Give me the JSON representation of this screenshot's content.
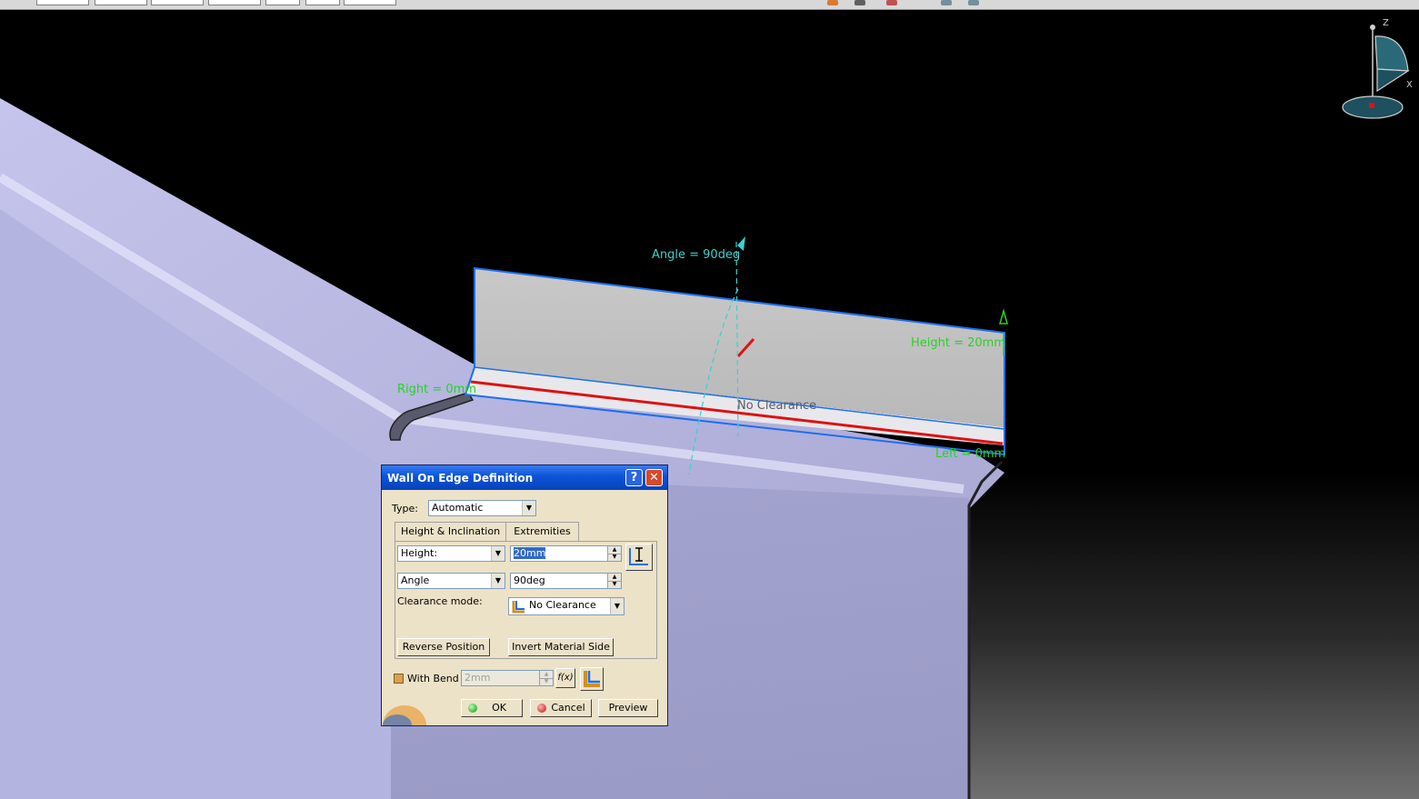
{
  "viewport": {
    "annotations": {
      "angle": "Angle = 90deg",
      "height": "Height = 20mm",
      "right": "Right = 0mm",
      "left": "Left = 0mm",
      "clearance": "No Clearance"
    },
    "compass": {
      "z": "Z",
      "x": "X"
    }
  },
  "dialog": {
    "title": "Wall On Edge Definition",
    "help": "?",
    "close": "✕",
    "type_label": "Type:",
    "type_value": "Automatic",
    "tabs": [
      {
        "label": "Height & Inclination"
      },
      {
        "label": "Extremities"
      }
    ],
    "height_mode": "Height:",
    "height_value": "20mm",
    "angle_mode": "Angle",
    "angle_value": "90deg",
    "clearance_label": "Clearance mode:",
    "clearance_value": "No Clearance",
    "reverse_position": "Reverse Position",
    "invert_material": "Invert Material Side",
    "with_bend_label": "With Bend",
    "bend_radius": "2mm",
    "fx": "f(x)",
    "ok": "OK",
    "cancel": "Cancel",
    "preview": "Preview"
  },
  "colors": {
    "dialog_bg": "#ece2c8",
    "title_bar": "#0a54d8",
    "dimension_green": "#28d228",
    "dimension_cyan": "#3cd0d0",
    "edge_blue": "#1e6ef0",
    "bend_red": "#e01010",
    "sheet_lavender": "#b4b4e0"
  }
}
